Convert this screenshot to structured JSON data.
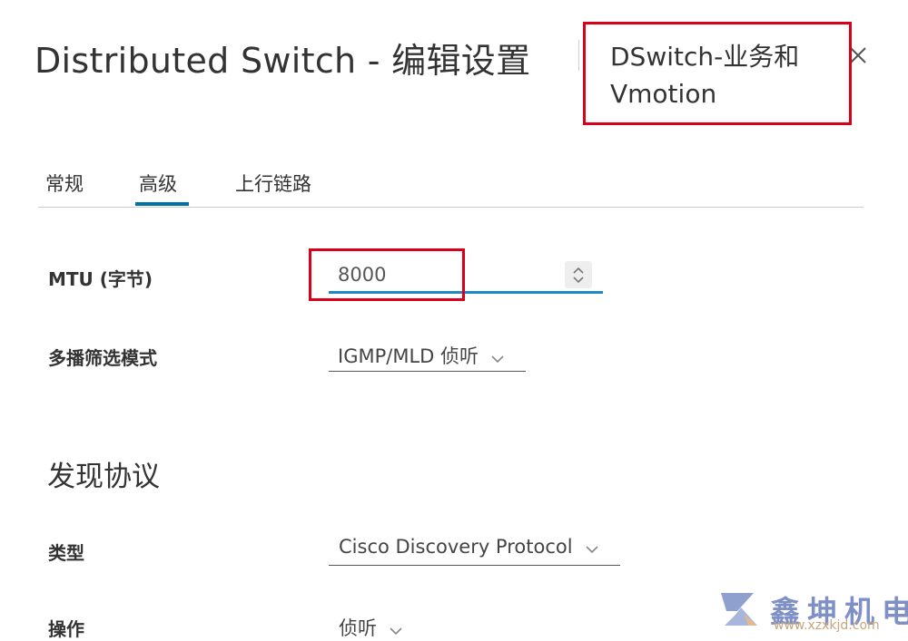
{
  "dialog": {
    "title": "Distributed Switch - 编辑设置",
    "object_name": "DSwitch-业务和Vmotion",
    "close_label": "×"
  },
  "tabs": [
    {
      "label": "常规",
      "active": false
    },
    {
      "label": "高级",
      "active": true
    },
    {
      "label": "上行链路",
      "active": false
    }
  ],
  "fields": {
    "mtu": {
      "label": "MTU (字节)",
      "value": "8000"
    },
    "multicast": {
      "label": "多播筛选模式",
      "value": "IGMP/MLD 侦听"
    }
  },
  "discovery": {
    "section_title": "发现协议",
    "type": {
      "label": "类型",
      "value": "Cisco Discovery Protocol"
    },
    "operation": {
      "label": "操作",
      "value": "侦听"
    }
  },
  "watermark": {
    "brand": "鑫坤机电",
    "url": "www.xzxkjd.com"
  },
  "colors": {
    "accent": "#0072a3",
    "input_focus": "#1e89c6",
    "highlight_box": "#d9001b",
    "watermark_blue": "#7f90c6",
    "watermark_orange": "#c9a47a"
  },
  "icons": [
    "close-icon",
    "spinner-up-icon",
    "spinner-down-icon",
    "chevron-down-icon",
    "brand-logo-icon"
  ]
}
